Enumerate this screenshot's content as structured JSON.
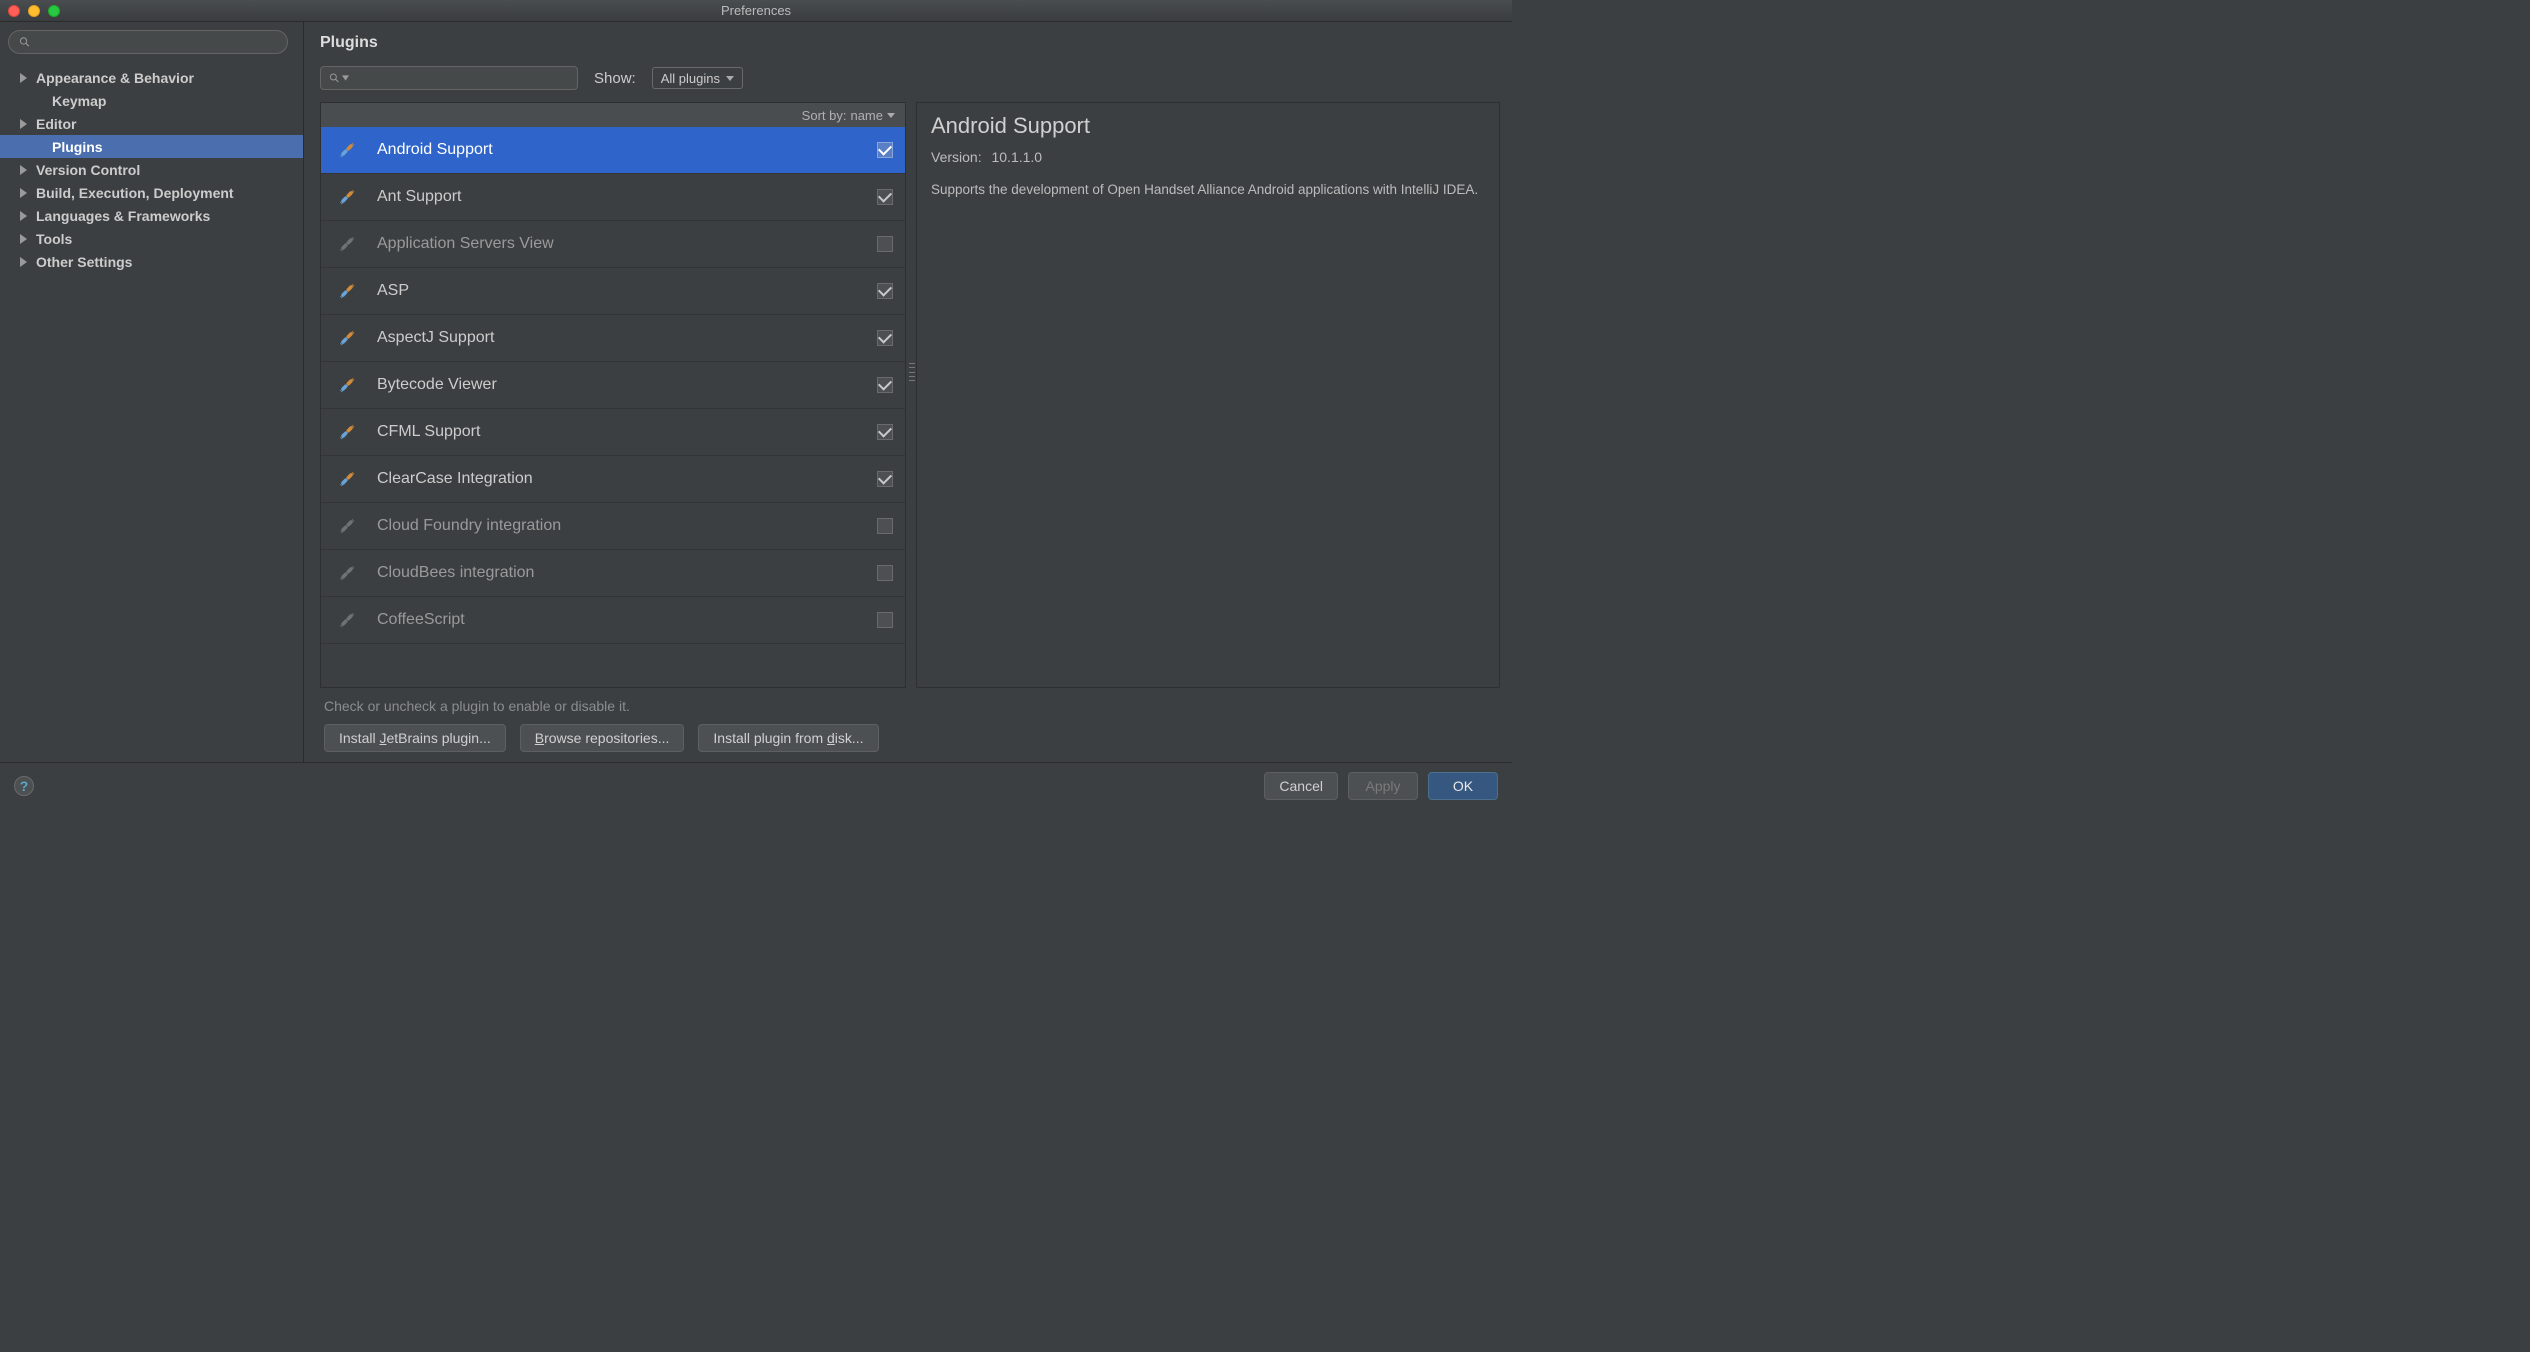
{
  "window": {
    "title": "Preferences"
  },
  "sidebar": {
    "search_placeholder": "",
    "items": [
      {
        "label": "Appearance & Behavior",
        "expandable": true
      },
      {
        "label": "Keymap",
        "expandable": false,
        "child": true
      },
      {
        "label": "Editor",
        "expandable": true
      },
      {
        "label": "Plugins",
        "expandable": false,
        "child": true,
        "selected": true
      },
      {
        "label": "Version Control",
        "expandable": true
      },
      {
        "label": "Build, Execution, Deployment",
        "expandable": true
      },
      {
        "label": "Languages & Frameworks",
        "expandable": true
      },
      {
        "label": "Tools",
        "expandable": true
      },
      {
        "label": "Other Settings",
        "expandable": true
      }
    ]
  },
  "main": {
    "title": "Plugins",
    "show_label": "Show:",
    "show_value": "All plugins",
    "sort_label": "Sort by:",
    "sort_value": "name"
  },
  "plugins": [
    {
      "name": "Android Support",
      "enabled": true,
      "selected": true
    },
    {
      "name": "Ant Support",
      "enabled": true
    },
    {
      "name": "Application Servers View",
      "enabled": false
    },
    {
      "name": "ASP",
      "enabled": true
    },
    {
      "name": "AspectJ Support",
      "enabled": true
    },
    {
      "name": "Bytecode Viewer",
      "enabled": true
    },
    {
      "name": "CFML Support",
      "enabled": true
    },
    {
      "name": "ClearCase Integration",
      "enabled": true
    },
    {
      "name": "Cloud Foundry integration",
      "enabled": false
    },
    {
      "name": "CloudBees integration",
      "enabled": false
    },
    {
      "name": "CoffeeScript",
      "enabled": false
    }
  ],
  "detail": {
    "title": "Android Support",
    "version_label": "Version:",
    "version_value": "10.1.1.0",
    "description": "Supports the development of Open Handset Alliance Android applications with IntelliJ IDEA."
  },
  "hint": "Check or uncheck a plugin to enable or disable it.",
  "buttons": {
    "install_jetbrains_pre": "Install ",
    "install_jetbrains_u": "J",
    "install_jetbrains_post": "etBrains plugin...",
    "browse_u": "B",
    "browse_post": "rowse repositories...",
    "install_disk_pre": "Install plugin from ",
    "install_disk_u": "d",
    "install_disk_post": "isk..."
  },
  "footer": {
    "cancel": "Cancel",
    "apply": "Apply",
    "ok": "OK"
  }
}
